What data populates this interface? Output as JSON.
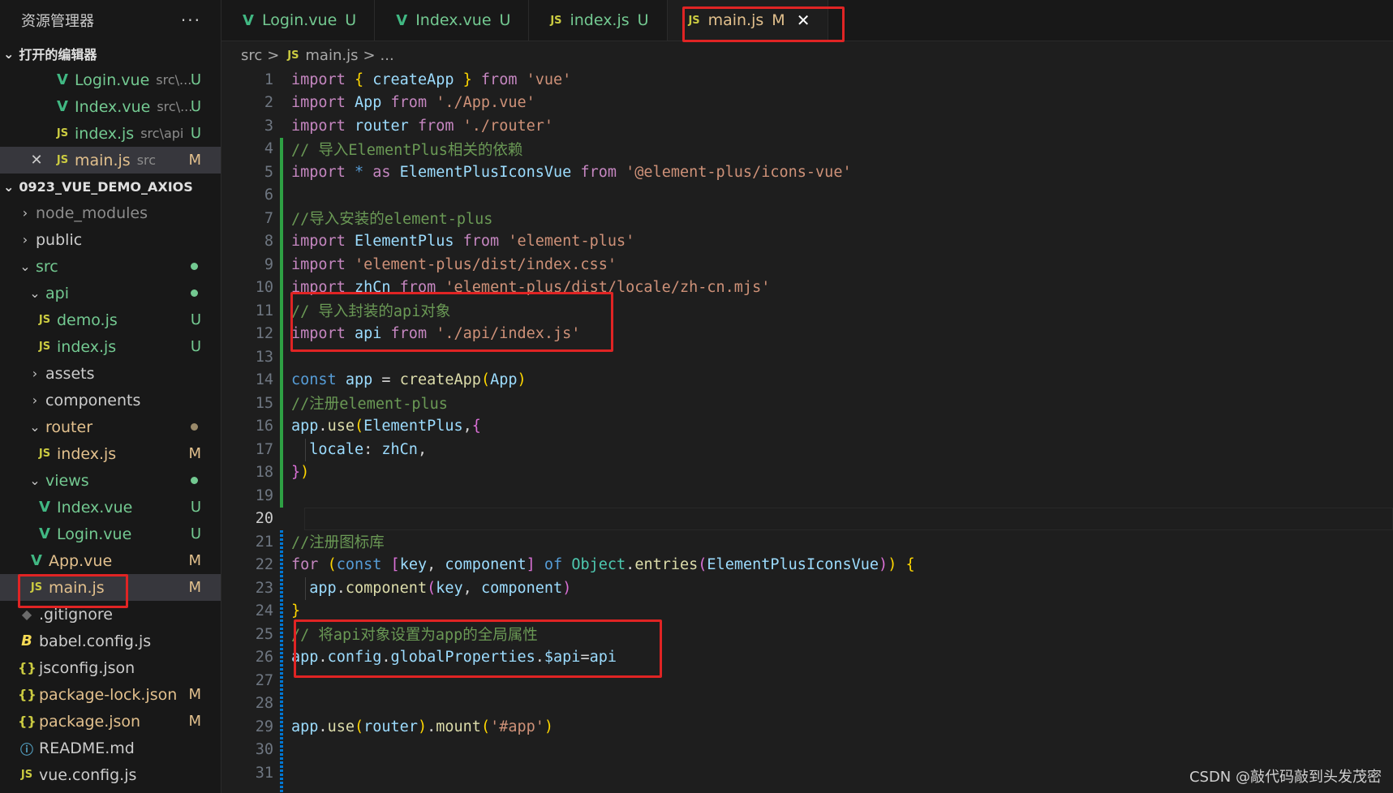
{
  "explorer": {
    "title": "资源管理器",
    "more": "···",
    "open_editors_title": "打开的编辑器",
    "open_editors": [
      {
        "icon": "vue",
        "name": "Login.vue",
        "desc": "src\\...",
        "status": "U"
      },
      {
        "icon": "vue",
        "name": "Index.vue",
        "desc": "src\\...",
        "status": "U"
      },
      {
        "icon": "js",
        "name": "index.js",
        "desc": "src\\api",
        "status": "U"
      },
      {
        "icon": "js",
        "name": "main.js",
        "desc": "src",
        "status": "M"
      }
    ],
    "project_title": "0923_VUE_DEMO_AXIOS",
    "tree": {
      "node_modules": "node_modules",
      "public": "public",
      "src": "src",
      "api": "api",
      "demo_js": "demo.js",
      "api_index_js": "index.js",
      "assets": "assets",
      "components": "components",
      "router": "router",
      "router_index_js": "index.js",
      "views": "views",
      "index_vue": "Index.vue",
      "login_vue": "Login.vue",
      "app_vue": "App.vue",
      "main_js": "main.js",
      "gitignore": ".gitignore",
      "babel": "babel.config.js",
      "jsconfig": "jsconfig.json",
      "package_lock": "package-lock.json",
      "package": "package.json",
      "readme": "README.md",
      "vue_config": "vue.config.js"
    },
    "status": {
      "U": "U",
      "M": "M"
    },
    "icons": {
      "js": "JS",
      "json": "{}",
      "vue": "V",
      "babel": "B",
      "info": "ⓘ",
      "git": "◆",
      "close": "✕",
      "chevron_right": "›",
      "chevron_down": "⌄"
    }
  },
  "tabs": [
    {
      "icon": "vue",
      "name": "Login.vue",
      "status": "U"
    },
    {
      "icon": "vue",
      "name": "Index.vue",
      "status": "U"
    },
    {
      "icon": "js",
      "name": "index.js",
      "status": "U"
    },
    {
      "icon": "js",
      "name": "main.js",
      "status": "M",
      "close": "✕"
    }
  ],
  "breadcrumb": {
    "folder": "src",
    "file": "main.js",
    "rest": "...",
    "sep": ">"
  },
  "line_numbers": [
    "1",
    "2",
    "3",
    "4",
    "5",
    "6",
    "7",
    "8",
    "9",
    "10",
    "11",
    "12",
    "13",
    "14",
    "15",
    "16",
    "17",
    "18",
    "19",
    "20",
    "21",
    "22",
    "23",
    "24",
    "25",
    "26",
    "27",
    "28",
    "29",
    "30",
    "31"
  ],
  "code": {
    "import": "import",
    "from": "from",
    "as": "as",
    "const": "const",
    "for": "for",
    "of": "of",
    "createApp": "createApp",
    "App": "App",
    "router": "router",
    "vue": "'vue'",
    "app_vue_path": "'./App.vue'",
    "router_path": "'./router'",
    "c4": "// 导入ElementPlus相关的依赖",
    "star": "*",
    "ElementPlusIconsVue": "ElementPlusIconsVue",
    "icons_path": "'@element-plus/icons-vue'",
    "c7": "//导入安装的element-plus",
    "ElementPlus": "ElementPlus",
    "ep_path": "'element-plus'",
    "css_path": "'element-plus/dist/index.css'",
    "zhCn": "zhCn",
    "locale_path": "'element-plus/dist/locale/zh-cn.mjs'",
    "c11": "// 导入封装的api对象",
    "api": "api",
    "api_path": "'./api/index.js'",
    "app": "app",
    "eq": " = ",
    "c15": "//注册element-plus",
    "use": "use",
    "locale": "locale",
    "c21": "//注册图标库",
    "key": "key",
    "component": "component",
    "Object": "Object",
    "entries": "entries",
    "c25": "// 将api对象设置为app的全局属性",
    "config": "config",
    "globalProperties": "globalProperties",
    "dollar_api": "$api",
    "mount": "mount",
    "app_sel": "'#app'"
  },
  "watermark": "CSDN @敲代码敲到头发茂密",
  "colors": {
    "highlight_box": "#e02424",
    "added_gutter": "#2ea043",
    "modified_gutter": "#0078d4",
    "untracked": "#73c991",
    "modified": "#e2c08d"
  }
}
